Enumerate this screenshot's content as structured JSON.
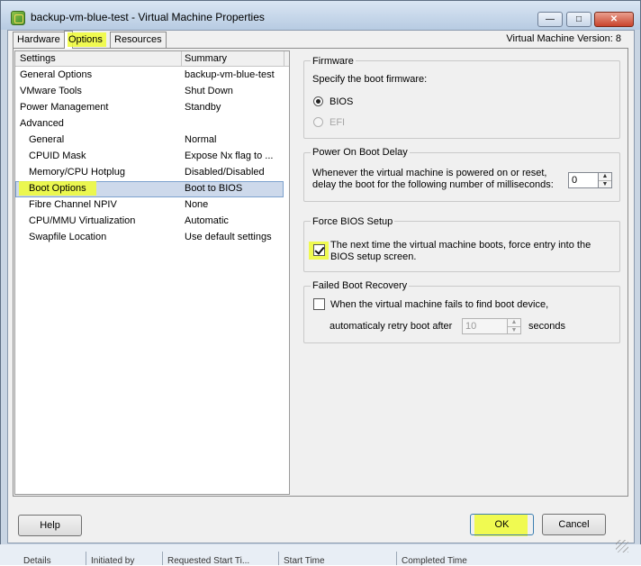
{
  "window": {
    "title": "backup-vm-blue-test - Virtual Machine Properties",
    "vm_version": "Virtual Machine Version: 8",
    "controls": {
      "minimize": "—",
      "maximize": "□",
      "close": "✕"
    }
  },
  "tabs": [
    {
      "label": "Hardware",
      "active": false
    },
    {
      "label": "Options",
      "active": true
    },
    {
      "label": "Resources",
      "active": false
    }
  ],
  "settings": {
    "header": {
      "settings": "Settings",
      "summary": "Summary"
    },
    "rows": [
      {
        "name": "General Options",
        "summary": "backup-vm-blue-test"
      },
      {
        "name": "VMware Tools",
        "summary": "Shut Down"
      },
      {
        "name": "Power Management",
        "summary": "Standby"
      },
      {
        "name": "Advanced",
        "summary": ""
      },
      {
        "name": "General",
        "summary": "Normal"
      },
      {
        "name": "CPUID Mask",
        "summary": "Expose Nx flag to ..."
      },
      {
        "name": "Memory/CPU Hotplug",
        "summary": "Disabled/Disabled"
      },
      {
        "name": "Boot Options",
        "summary": "Boot to BIOS",
        "selected": true
      },
      {
        "name": "Fibre Channel NPIV",
        "summary": "None"
      },
      {
        "name": "CPU/MMU Virtualization",
        "summary": "Automatic"
      },
      {
        "name": "Swapfile Location",
        "summary": "Use default settings"
      }
    ]
  },
  "firmware": {
    "title": "Firmware",
    "prompt": "Specify the boot firmware:",
    "options": [
      {
        "label": "BIOS",
        "selected": true,
        "enabled": true
      },
      {
        "label": "EFI",
        "selected": false,
        "enabled": false
      }
    ]
  },
  "power_on_delay": {
    "title": "Power On Boot Delay",
    "description": "Whenever the virtual machine is powered on or reset, delay the boot for the following number of milliseconds:",
    "value": "0"
  },
  "force_bios": {
    "title": "Force BIOS Setup",
    "checked": true,
    "label": "The next time the virtual machine boots, force entry into the BIOS setup screen."
  },
  "failed_recovery": {
    "title": "Failed Boot Recovery",
    "checked": false,
    "label": "When the virtual machine fails to find boot device,",
    "retry_label": "automaticaly retry boot after",
    "retry_value": "10",
    "seconds_label": "seconds"
  },
  "buttons": {
    "help": "Help",
    "ok": "OK",
    "cancel": "Cancel"
  },
  "background_columns": [
    "Details",
    "Initiated by",
    "Requested Start Ti...",
    "Start Time",
    "Completed Time"
  ],
  "highlight_color": "#f0fb35"
}
